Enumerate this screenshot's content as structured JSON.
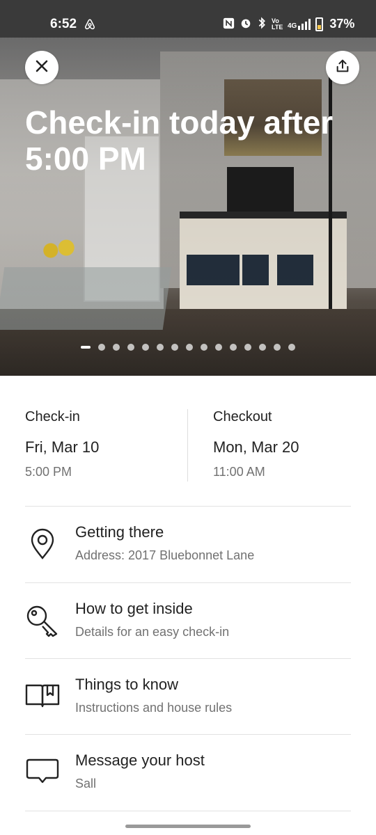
{
  "status_bar": {
    "time": "6:52",
    "battery": "37%",
    "icons": [
      "airbnb-icon",
      "nfc-icon",
      "alarm-icon",
      "bluetooth-icon",
      "volte-icon",
      "signal-4g-icon",
      "battery-icon"
    ],
    "volte_label": "Vo LTE",
    "network_label": "4G"
  },
  "hero": {
    "title": "Check-in today after 5:00 PM",
    "photo_count": 15,
    "active_photo_index": 0
  },
  "reservation": {
    "checkin": {
      "label": "Check-in",
      "date": "Fri, Mar 10",
      "time": "5:00 PM"
    },
    "checkout": {
      "label": "Checkout",
      "date": "Mon, Mar 20",
      "time": "11:00 AM"
    }
  },
  "items": [
    {
      "title": "Getting there",
      "subtitle": "Address: 2017 Bluebonnet Lane",
      "icon": "location-pin-icon"
    },
    {
      "title": "How to get inside",
      "subtitle": "Details for an easy check-in",
      "icon": "key-icon"
    },
    {
      "title": "Things to know",
      "subtitle": "Instructions and house rules",
      "icon": "book-icon"
    },
    {
      "title": "Message your host",
      "subtitle": "Sall",
      "icon": "chat-bubble-icon"
    }
  ]
}
